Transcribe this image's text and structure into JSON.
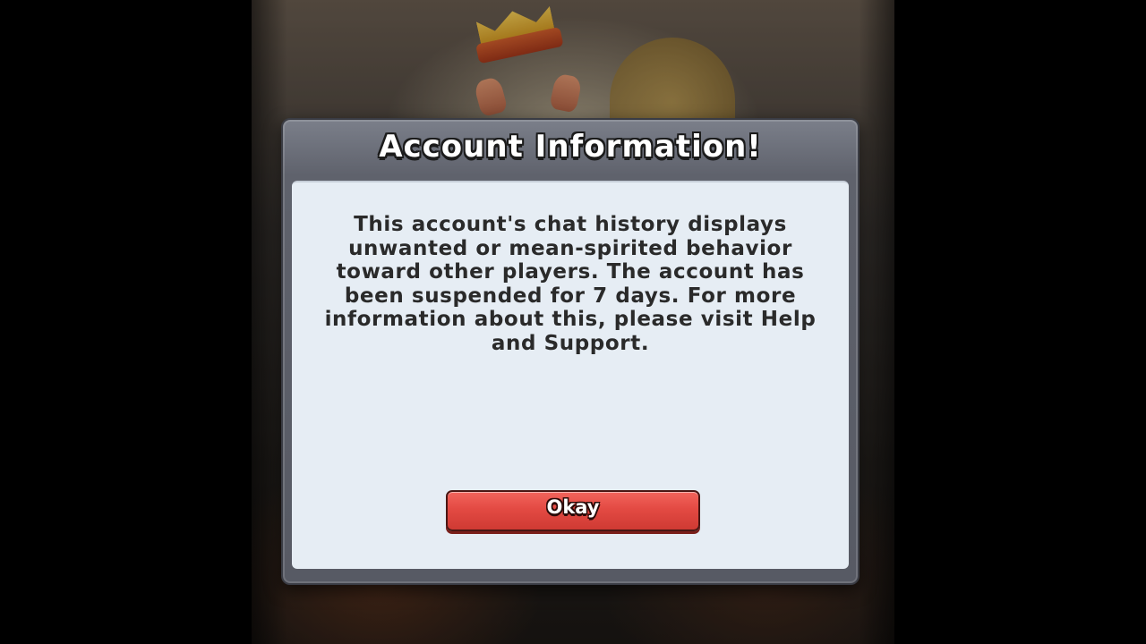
{
  "dialog": {
    "title": "Account Information!",
    "message": "This account's chat history displays unwanted or mean-spirited behavior toward other players. The account has been suspended for 7 days. For more information about this, please visit Help and Support.",
    "okay_label": "Okay"
  },
  "colors": {
    "dialog_frame": "#5f626c",
    "panel": "#e6edf4",
    "button": "#e34a43",
    "text": "#2a2a2a"
  }
}
